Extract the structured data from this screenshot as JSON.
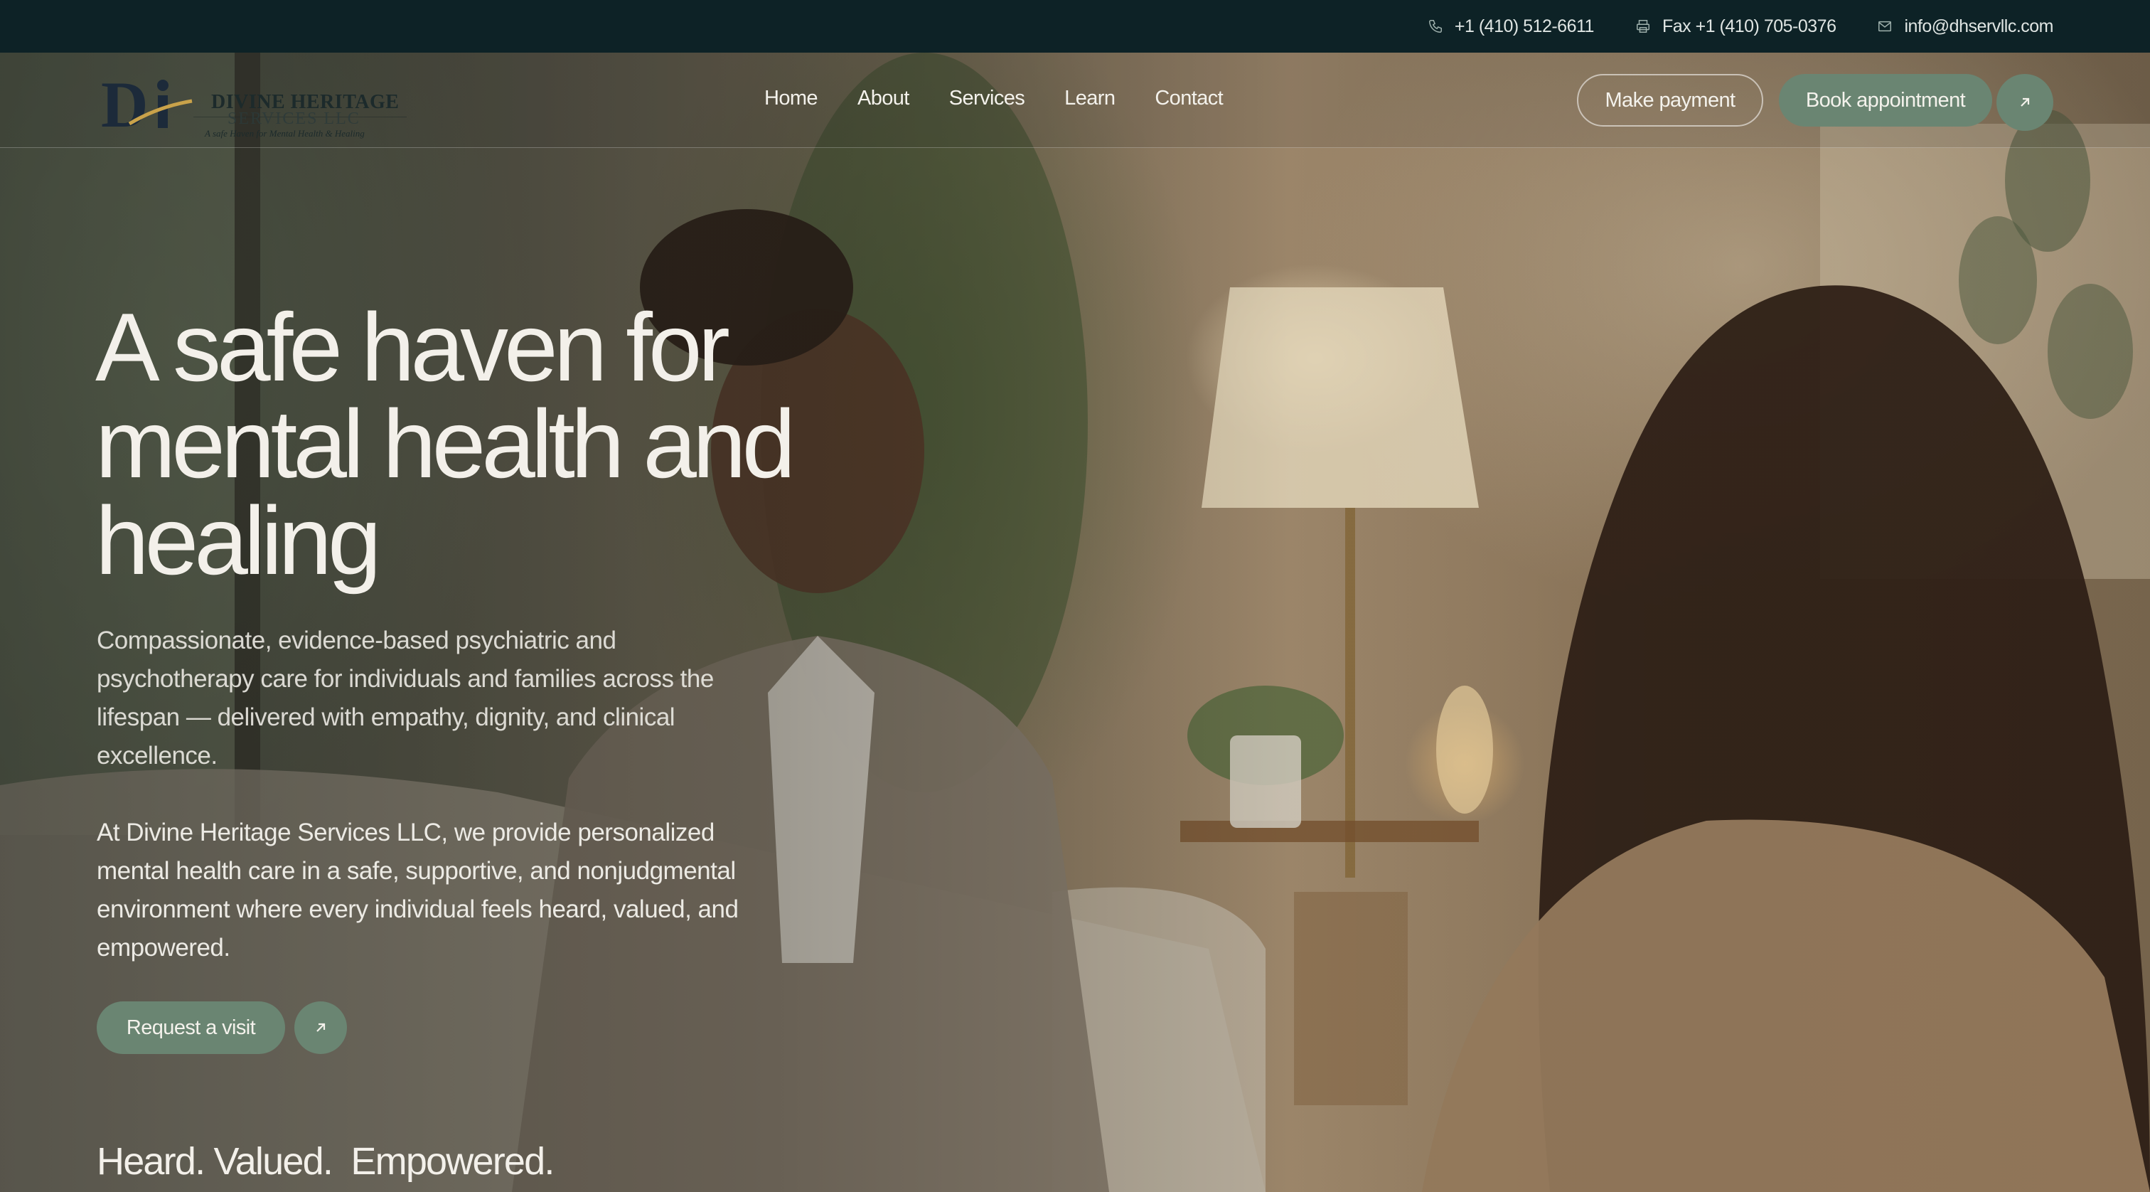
{
  "topbar": {
    "phone": "+1 (410) 512-6611",
    "fax": "Fax +1 (410) 705-0376",
    "email": "info@dhservllc.com"
  },
  "logo": {
    "name": "DIVINE HERITAGE",
    "sub": "SERVICES LLC",
    "tagline": "A safe Haven for Mental Health & Healing"
  },
  "nav": {
    "items": [
      "Home",
      "About",
      "Services",
      "Learn",
      "Contact"
    ]
  },
  "header_actions": {
    "make_payment": "Make payment",
    "book_appointment": "Book appointment"
  },
  "hero": {
    "headline_lines": [
      "A safe haven for",
      "mental health and",
      "healing"
    ],
    "paragraph1": "Compassionate, evidence-based psychiatric and psychotherapy care for individuals and families across the lifespan — delivered with empathy, dignity, and clinical excellence.",
    "paragraph2": "At Divine Heritage Services LLC, we provide personalized mental health care in a safe, supportive, and nonjudgmental environment where every individual feels heard, valued, and empowered.",
    "cta_label": "Request a visit",
    "tagline": "Heard. Valued.  Empowered."
  },
  "colors": {
    "topbar_bg": "#0d2226",
    "accent_green": "#6a8572",
    "text_light": "#f3f0ea"
  },
  "icons": {
    "phone": "phone-icon",
    "fax": "printer-icon",
    "email": "mail-icon",
    "arrow": "arrow-up-right-icon"
  }
}
